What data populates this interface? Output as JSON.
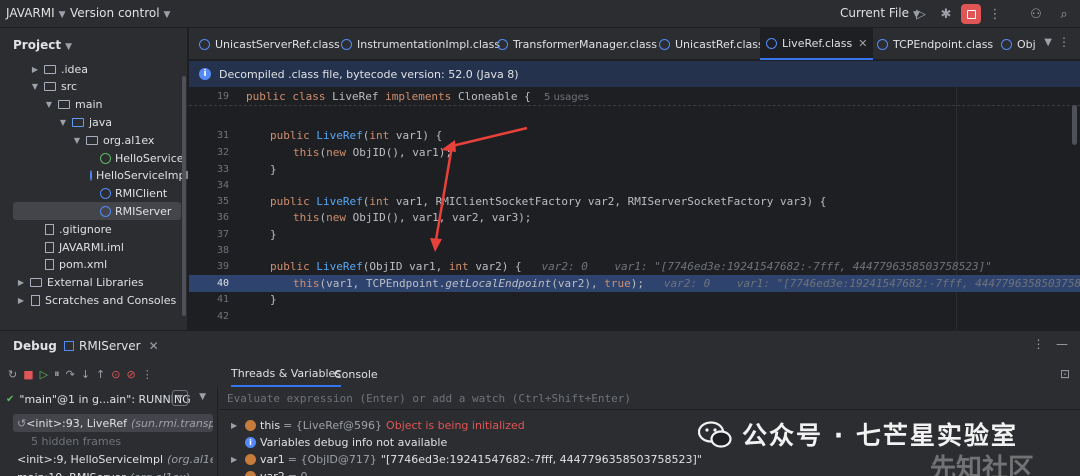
{
  "titlebar": {
    "project": "JAVARMI",
    "vcs": "Version control",
    "run_config": "Current File"
  },
  "project_panel": {
    "title": "Project",
    "tree": [
      {
        "label": ".idea",
        "kind": "folder",
        "indent": 1
      },
      {
        "label": "src",
        "kind": "folder",
        "indent": 1
      },
      {
        "label": "main",
        "kind": "folder",
        "indent": 2
      },
      {
        "label": "java",
        "kind": "folder-blue",
        "indent": 3
      },
      {
        "label": "org.al1ex",
        "kind": "package",
        "indent": 4
      },
      {
        "label": "HelloService",
        "kind": "interface",
        "indent": 5
      },
      {
        "label": "HelloServiceImpl",
        "kind": "class",
        "indent": 5
      },
      {
        "label": "RMIClient",
        "kind": "class",
        "indent": 5
      },
      {
        "label": "RMIServer",
        "kind": "class",
        "indent": 5
      },
      {
        "label": ".gitignore",
        "kind": "file",
        "indent": 1
      },
      {
        "label": "JAVARMI.iml",
        "kind": "file",
        "indent": 1
      },
      {
        "label": "pom.xml",
        "kind": "file",
        "indent": 1
      },
      {
        "label": "External Libraries",
        "kind": "lib",
        "indent": 0
      },
      {
        "label": "Scratches and Consoles",
        "kind": "scratch",
        "indent": 0
      }
    ]
  },
  "tabs": [
    {
      "label": "UnicastServerRef.class"
    },
    {
      "label": "InstrumentationImpl.class"
    },
    {
      "label": "TransformerManager.class"
    },
    {
      "label": "UnicastRef.class"
    },
    {
      "label": "LiveRef.class",
      "active": true
    },
    {
      "label": "TCPEndpoint.class"
    },
    {
      "label": "Obj"
    }
  ],
  "banner": {
    "text": "Decompiled .class file, bytecode version: 52.0 (Java 8)"
  },
  "editor": {
    "line_numbers": [
      "19",
      "31",
      "32",
      "33",
      "34",
      "35",
      "36",
      "37",
      "38",
      "39",
      "40",
      "41",
      "42"
    ],
    "l19_a": "public class ",
    "l19_b": "LiveRef ",
    "l19_c": "implements ",
    "l19_d": "Cloneable {",
    "l19_hint": "5 usages",
    "l31_a": "public ",
    "l31_b": "LiveRef",
    "l31_c": "(",
    "l31_d": "int ",
    "l31_e": "var1) {",
    "l32_a": "this",
    "l32_b": "(",
    "l32_c": "new ",
    "l32_d": "ObjID(), var1);",
    "close": "}",
    "l35_a": "public ",
    "l35_b": "LiveRef",
    "l35_c": "(",
    "l35_d": "int ",
    "l35_e": "var1, RMIClientSocketFactory var2, RMIServerSocketFactory var3) {",
    "l36_a": "this",
    "l36_b": "(",
    "l36_c": "new ",
    "l36_d": "ObjID(), var1, var2, var3);",
    "l39_a": "public ",
    "l39_b": "LiveRef",
    "l39_c": "(ObjID var1, ",
    "l39_d": "int ",
    "l39_e": "var2) {",
    "l39_hint": "var2: 0    var1: \"[7746ed3e:19241547682:-7fff, 4447796358503758523]\"",
    "l40_a": "this",
    "l40_b": "(var1, TCPEndpoint.",
    "l40_c": "getLocalEndpoint",
    "l40_d": "(var2), ",
    "l40_e": "true",
    "l40_f": ");",
    "l40_hint": "var2: 0    var1: \"[7746ed3e:19241547682:-7fff, 4447796358503758523]\""
  },
  "debug": {
    "title": "Debug",
    "config": "RMIServer",
    "thread": "\"main\"@1 in g...ain\": RUNNING",
    "frames": [
      {
        "method": "<init>:93, LiveRef",
        "pkg": "(sun.rmi.transport)",
        "selected": true
      },
      {
        "method": "5 hidden frames",
        "pkg": "",
        "dim": true
      },
      {
        "method": "<init>:9, HelloServiceImpl",
        "pkg": "(org.al1ex)"
      },
      {
        "method": "main:10, RMIServer",
        "pkg": "(org.al1ex)"
      }
    ],
    "tabs": [
      "Threads & Variables",
      "Console"
    ],
    "eval_placeholder": "Evaluate expression (Enter) or add a watch (Ctrl+Shift+Enter)",
    "vars": {
      "this_name": "this",
      "this_ref": "= {LiveRef@596}",
      "this_msg": "Object is being initialized",
      "info": "Variables debug info not available",
      "var1_name": "var1",
      "var1_ref": "= {ObjID@717}",
      "var1_val": "\"[7746ed3e:19241547682:-7fff, 4447796358503758523]\"",
      "var2_name": "var2",
      "var2_val": "= 0"
    }
  },
  "watermark": {
    "text": "公众号 · 七芒星实验室",
    "site": "先知社区"
  },
  "colors": {
    "accent": "#3574f0",
    "annotation": "#e8413a"
  }
}
